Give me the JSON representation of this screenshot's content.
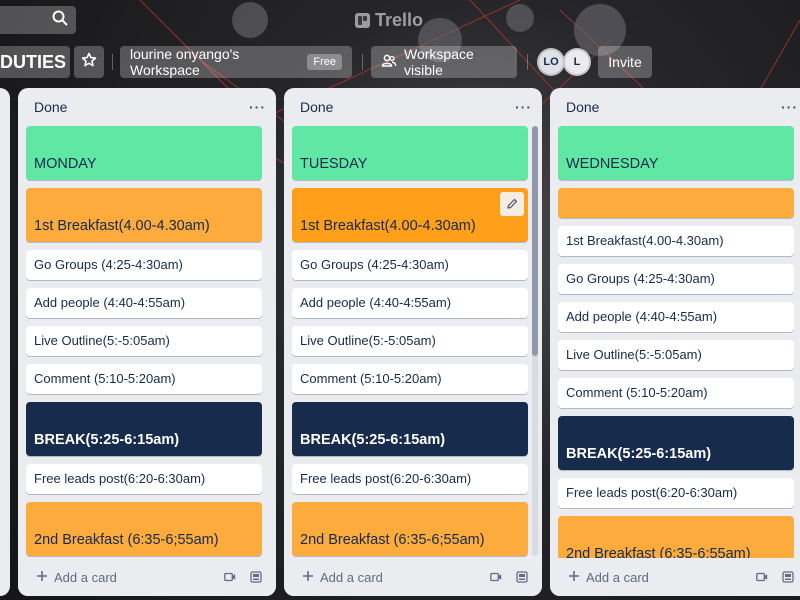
{
  "header": {
    "logo_text": "Trello"
  },
  "board": {
    "title": "DUTIES",
    "workspace_name": "lourine onyango's Workspace",
    "workspace_badge": "Free",
    "visibility_label": "Workspace visible",
    "members": [
      "LO",
      "L"
    ],
    "invite_label": "Invite"
  },
  "lists": [
    {
      "title": "Done",
      "menu": "···",
      "cards": [
        {
          "text": "MONDAY",
          "style": "green"
        },
        {
          "text": "1st Breakfast(4.00-4.30am)",
          "style": "orange"
        },
        {
          "text": "Go Groups (4:25-4:30am)",
          "style": "plain"
        },
        {
          "text": "Add people (4:40-4:55am)",
          "style": "plain"
        },
        {
          "text": "Live Outline(5:-5:05am)",
          "style": "plain"
        },
        {
          "text": "Comment (5:10-5:20am)",
          "style": "plain"
        },
        {
          "text": "BREAK(5:25-6:15am)",
          "style": "navy"
        },
        {
          "text": "Free leads post(6:20-6:30am)",
          "style": "plain"
        },
        {
          "text": "2nd Breakfast (6:35-6;55am)",
          "style": "orange"
        }
      ],
      "add_card_label": "Add a card"
    },
    {
      "title": "Done",
      "menu": "···",
      "cards": [
        {
          "text": "TUESDAY",
          "style": "green"
        },
        {
          "text": "1st Breakfast(4.00-4.30am)",
          "style": "orange-full"
        },
        {
          "text": "Go Groups (4:25-4:30am)",
          "style": "plain"
        },
        {
          "text": "Add people (4:40-4:55am)",
          "style": "plain"
        },
        {
          "text": "Live Outline(5:-5:05am)",
          "style": "plain"
        },
        {
          "text": "Comment (5:10-5:20am)",
          "style": "plain"
        },
        {
          "text": "BREAK(5:25-6:15am)",
          "style": "navy"
        },
        {
          "text": "Free leads post(6:20-6:30am)",
          "style": "plain"
        },
        {
          "text": "2nd Breakfast (6:35-6;55am)",
          "style": "orange"
        }
      ],
      "add_card_label": "Add a card"
    },
    {
      "title": "Done",
      "menu": "···",
      "cards": [
        {
          "text": "WEDNESDAY",
          "style": "green"
        },
        {
          "text": "",
          "style": "empty-orange"
        },
        {
          "text": "1st Breakfast(4.00-4.30am)",
          "style": "plain"
        },
        {
          "text": "Go Groups (4:25-4:30am)",
          "style": "plain"
        },
        {
          "text": "Add people (4:40-4:55am)",
          "style": "plain"
        },
        {
          "text": "Live Outline(5:-5:05am)",
          "style": "plain"
        },
        {
          "text": "Comment (5:10-5:20am)",
          "style": "plain"
        },
        {
          "text": "BREAK(5:25-6:15am)",
          "style": "navy"
        },
        {
          "text": "Free leads post(6:20-6:30am)",
          "style": "plain"
        },
        {
          "text": "2nd Breakfast (6:35-6;55am)",
          "style": "orange"
        }
      ],
      "add_card_label": "Add a card"
    }
  ],
  "colors": {
    "green_label": "#61e7a4",
    "orange_label": "#fdab3d",
    "navy_label": "#172b4d",
    "list_bg": "#ebecf0"
  },
  "icons": {
    "search": "search-icon",
    "star": "star-icon",
    "visibility": "people-icon",
    "edit": "pencil-icon",
    "add": "plus-icon",
    "template": "template-icon",
    "camera": "camera-icon"
  }
}
